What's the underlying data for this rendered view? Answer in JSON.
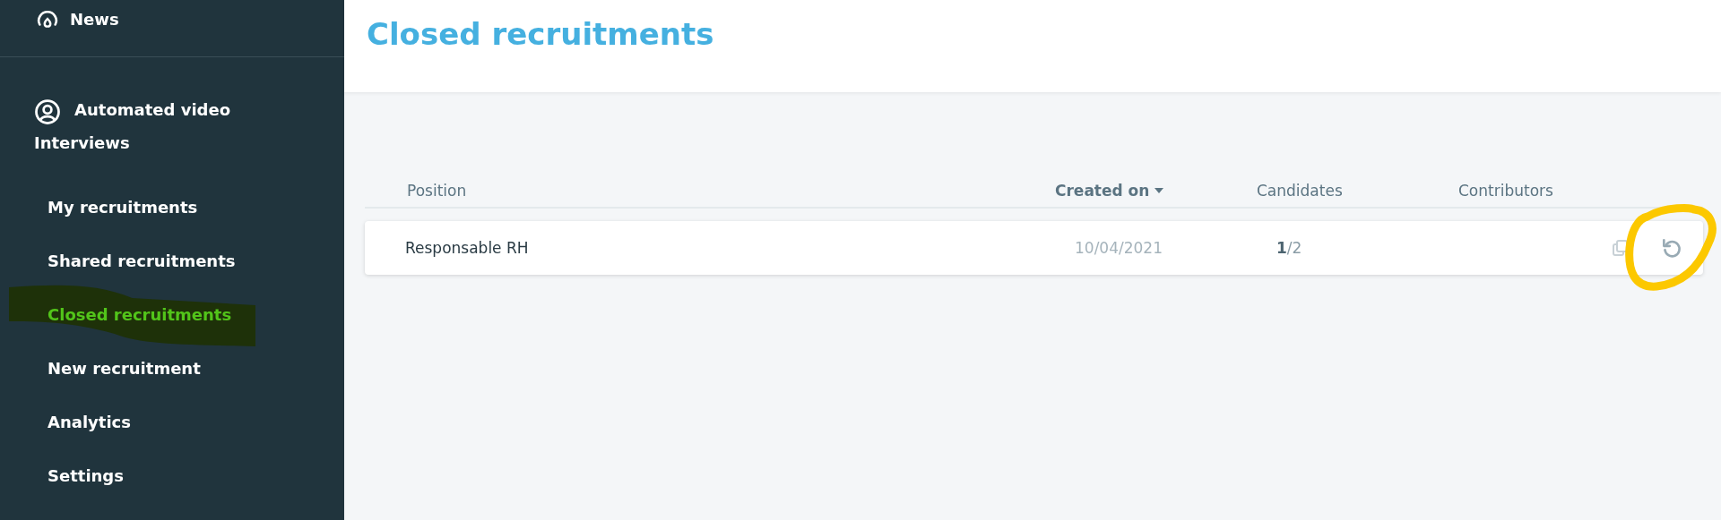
{
  "sidebar": {
    "top_item": {
      "label": "News"
    },
    "section": {
      "label_lines": [
        "Automated video",
        "Interviews"
      ]
    },
    "items": [
      {
        "label": "My recruitments",
        "selected": false
      },
      {
        "label": "Shared recruitments",
        "selected": false
      },
      {
        "label": "Closed recruitments",
        "selected": true
      },
      {
        "label": "New recruitment",
        "selected": false
      },
      {
        "label": "Analytics",
        "selected": false
      },
      {
        "label": "Settings",
        "selected": false
      }
    ]
  },
  "page": {
    "title": "Closed recruitments"
  },
  "table": {
    "columns": [
      {
        "label": "Position",
        "sorted": false
      },
      {
        "label": "Created on",
        "sorted": true
      },
      {
        "label": "Candidates",
        "sorted": false
      },
      {
        "label": "Contributors",
        "sorted": false
      }
    ],
    "rows": [
      {
        "position": "Responsable RH",
        "created_on": "10/04/2021",
        "candidates_done": "1",
        "candidates_total": "/2"
      }
    ]
  }
}
